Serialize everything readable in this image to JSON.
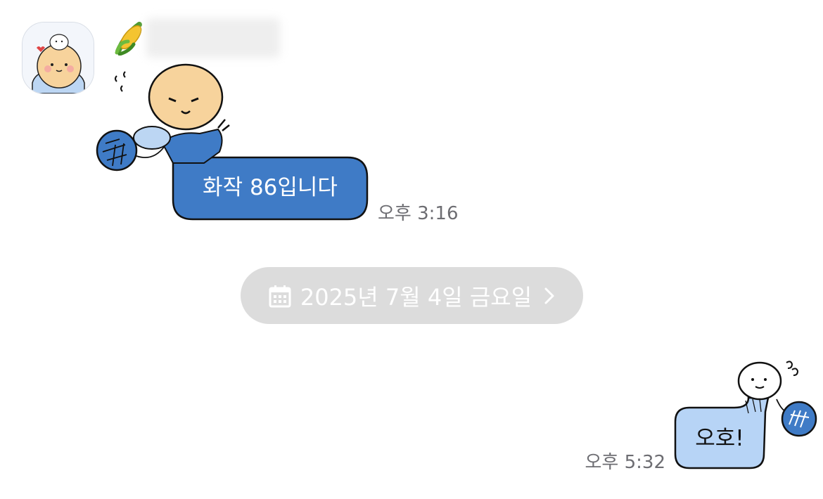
{
  "chat": {
    "incoming": {
      "avatar": "avatar-bear-sticker",
      "sender_badge_icon": "corn-icon",
      "sender_name": "",
      "message_text": "화작 86입니다",
      "time": "오후 3:16"
    },
    "date_divider": {
      "icon": "calendar-icon",
      "label": "2025년 7월 4일 금요일",
      "chevron_icon": "chevron-right-icon"
    },
    "outgoing": {
      "message_text": "오호!",
      "time": "오후 5:32"
    }
  },
  "colors": {
    "incoming_bubble": "#3f7bc6",
    "outgoing_bubble": "#b7d4f6",
    "date_pill": "#dcdcdc",
    "time_text": "#6d6d72",
    "bear_fur": "#f7d39c"
  }
}
